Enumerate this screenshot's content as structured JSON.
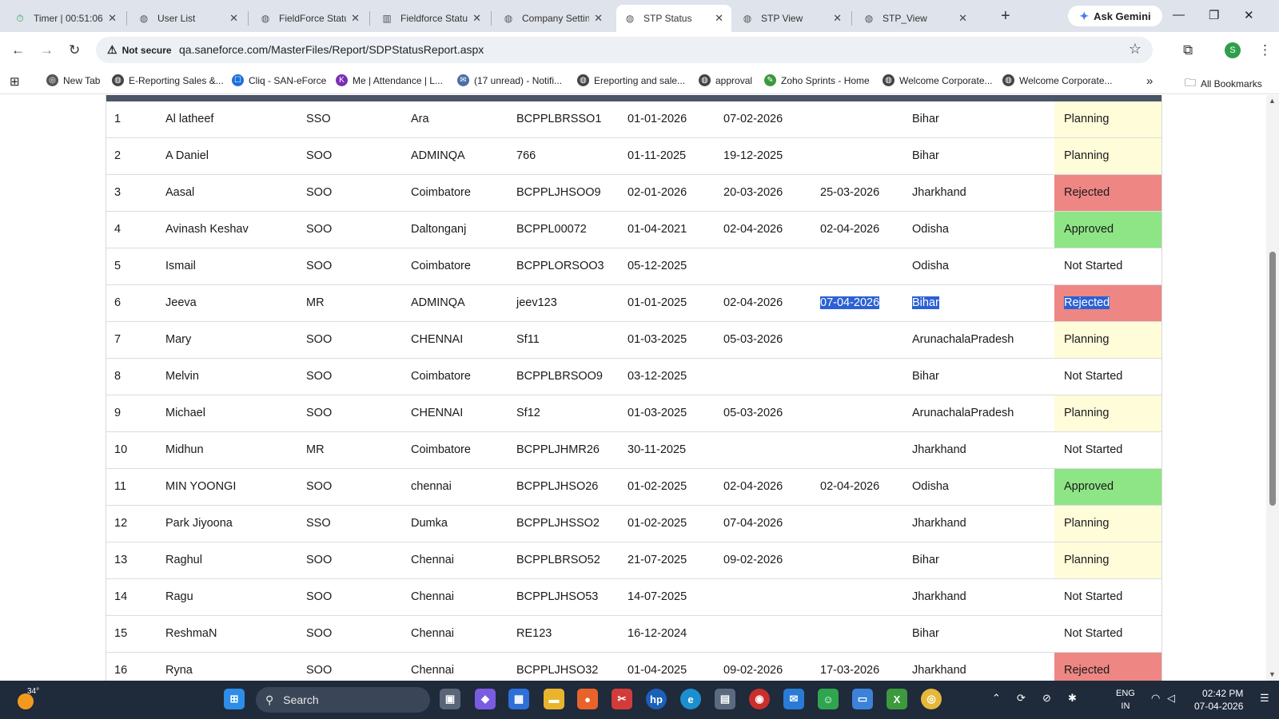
{
  "tabs": [
    {
      "title": "Timer | 00:51:06",
      "icon": "timer-icon",
      "active": false
    },
    {
      "title": "User List",
      "icon": "globe-icon",
      "active": false
    },
    {
      "title": "FieldForce Statu",
      "icon": "globe-icon",
      "active": false
    },
    {
      "title": "Fieldforce Statu",
      "icon": "report-icon",
      "active": false
    },
    {
      "title": "Company Settin",
      "icon": "globe-icon",
      "active": false
    },
    {
      "title": "STP Status",
      "icon": "globe-icon",
      "active": true
    },
    {
      "title": "STP View",
      "icon": "globe-icon",
      "active": false
    },
    {
      "title": "STP_View",
      "icon": "globe-icon",
      "active": false
    }
  ],
  "gemini_label": "Ask Gemini",
  "address": {
    "security_label": "Not secure",
    "url": "qa.saneforce.com/MasterFiles/Report/SDPStatusReport.aspx"
  },
  "profile_initial": "S",
  "bookmarks": [
    {
      "label": "New Tab",
      "icon": "chrome-icon",
      "color": "#555555"
    },
    {
      "label": "E-Reporting Sales &...",
      "icon": "globe-icon",
      "color": "#444444"
    },
    {
      "label": "Cliq - SAN-eForce",
      "icon": "cliq-icon",
      "color": "#1e6fd9"
    },
    {
      "label": "Me | Attendance | L...",
      "icon": "kiosk-icon",
      "color": "#7b2fb5"
    },
    {
      "label": "(17 unread) - Notifi...",
      "icon": "mail-icon",
      "color": "#4b6ea8"
    },
    {
      "label": "Ereporting and sale...",
      "icon": "globe-icon",
      "color": "#444444"
    },
    {
      "label": "approval",
      "icon": "globe-icon",
      "color": "#444444"
    },
    {
      "label": "Zoho Sprints - Home",
      "icon": "sprints-icon",
      "color": "#3a9a3a"
    },
    {
      "label": "Welcome Corporate...",
      "icon": "globe-icon",
      "color": "#444444"
    },
    {
      "label": "Welcome Corporate...",
      "icon": "globe-icon",
      "color": "#444444"
    }
  ],
  "all_bookmarks_label": "All Bookmarks",
  "status_colors": {
    "Planning": "#fffcda",
    "Rejected": "#ee8683",
    "Approved": "#8ee585",
    "Not Started": "#ffffff"
  },
  "rows": [
    {
      "no": "1",
      "name": "Al latheef",
      "desig": "SSO",
      "hq": "Ara",
      "code": "BCPPLBRSSO1",
      "from": "01-01-2026",
      "to": "07-02-2026",
      "approved": "",
      "state": "Bihar",
      "status": "Planning"
    },
    {
      "no": "2",
      "name": "A Daniel",
      "desig": "SOO",
      "hq": "ADMINQA",
      "code": "766",
      "from": "01-11-2025",
      "to": "19-12-2025",
      "approved": "",
      "state": "Bihar",
      "status": "Planning"
    },
    {
      "no": "3",
      "name": "Aasal",
      "desig": "SOO",
      "hq": "Coimbatore",
      "code": "BCPPLJHSOO9",
      "from": "02-01-2026",
      "to": "20-03-2026",
      "approved": "25-03-2026",
      "state": "Jharkhand",
      "status": "Rejected"
    },
    {
      "no": "4",
      "name": "Avinash Keshav",
      "desig": "SOO",
      "hq": "Daltonganj",
      "code": "BCPPL00072",
      "from": "01-04-2021",
      "to": "02-04-2026",
      "approved": "02-04-2026",
      "state": "Odisha",
      "status": "Approved"
    },
    {
      "no": "5",
      "name": "Ismail",
      "desig": "SOO",
      "hq": "Coimbatore",
      "code": "BCPPLORSOO3",
      "from": "05-12-2025",
      "to": "",
      "approved": "",
      "state": "Odisha",
      "status": "Not Started"
    },
    {
      "no": "6",
      "name": "Jeeva",
      "desig": "MR",
      "hq": "ADMINQA",
      "code": "jeev123",
      "from": "01-01-2025",
      "to": "02-04-2026",
      "approved": "07-04-2026",
      "state": "Bihar",
      "status": "Rejected",
      "selected": true
    },
    {
      "no": "7",
      "name": "Mary",
      "desig": "SOO",
      "hq": "CHENNAI",
      "code": "Sf11",
      "from": "01-03-2025",
      "to": "05-03-2026",
      "approved": "",
      "state": "ArunachalaPradesh",
      "status": "Planning"
    },
    {
      "no": "8",
      "name": "Melvin",
      "desig": "SOO",
      "hq": "Coimbatore",
      "code": "BCPPLBRSOO9",
      "from": "03-12-2025",
      "to": "",
      "approved": "",
      "state": "Bihar",
      "status": "Not Started"
    },
    {
      "no": "9",
      "name": "Michael",
      "desig": "SOO",
      "hq": "CHENNAI",
      "code": "Sf12",
      "from": "01-03-2025",
      "to": "05-03-2026",
      "approved": "",
      "state": "ArunachalaPradesh",
      "status": "Planning"
    },
    {
      "no": "10",
      "name": "Midhun",
      "desig": "MR",
      "hq": "Coimbatore",
      "code": "BCPPLJHMR26",
      "from": "30-11-2025",
      "to": "",
      "approved": "",
      "state": "Jharkhand",
      "status": "Not Started"
    },
    {
      "no": "11",
      "name": "MIN YOONGI",
      "desig": "SOO",
      "hq": "chennai",
      "code": "BCPPLJHSO26",
      "from": "01-02-2025",
      "to": "02-04-2026",
      "approved": "02-04-2026",
      "state": "Odisha",
      "status": "Approved"
    },
    {
      "no": "12",
      "name": "Park Jiyoona",
      "desig": "SSO",
      "hq": "Dumka",
      "code": "BCPPLJHSSO2",
      "from": "01-02-2025",
      "to": "07-04-2026",
      "approved": "",
      "state": "Jharkhand",
      "status": "Planning"
    },
    {
      "no": "13",
      "name": "Raghul",
      "desig": "SOO",
      "hq": "Chennai",
      "code": "BCPPLBRSO52",
      "from": "21-07-2025",
      "to": "09-02-2026",
      "approved": "",
      "state": "Bihar",
      "status": "Planning"
    },
    {
      "no": "14",
      "name": "Ragu",
      "desig": "SOO",
      "hq": "Chennai",
      "code": "BCPPLJHSO53",
      "from": "14-07-2025",
      "to": "",
      "approved": "",
      "state": "Jharkhand",
      "status": "Not Started"
    },
    {
      "no": "15",
      "name": "ReshmaN",
      "desig": "SOO",
      "hq": "Chennai",
      "code": "RE123",
      "from": "16-12-2024",
      "to": "",
      "approved": "",
      "state": "Bihar",
      "status": "Not Started"
    },
    {
      "no": "16",
      "name": "Ryna",
      "desig": "SOO",
      "hq": "Chennai",
      "code": "BCPPLJHSO32",
      "from": "01-04-2025",
      "to": "09-02-2026",
      "approved": "17-03-2026",
      "state": "Jharkhand",
      "status": "Rejected"
    }
  ],
  "taskbar": {
    "weather_temp": "34°",
    "search_placeholder": "Search",
    "lang_line1": "ENG",
    "lang_line2": "IN",
    "time": "02:42 PM",
    "date": "07-04-2026"
  }
}
